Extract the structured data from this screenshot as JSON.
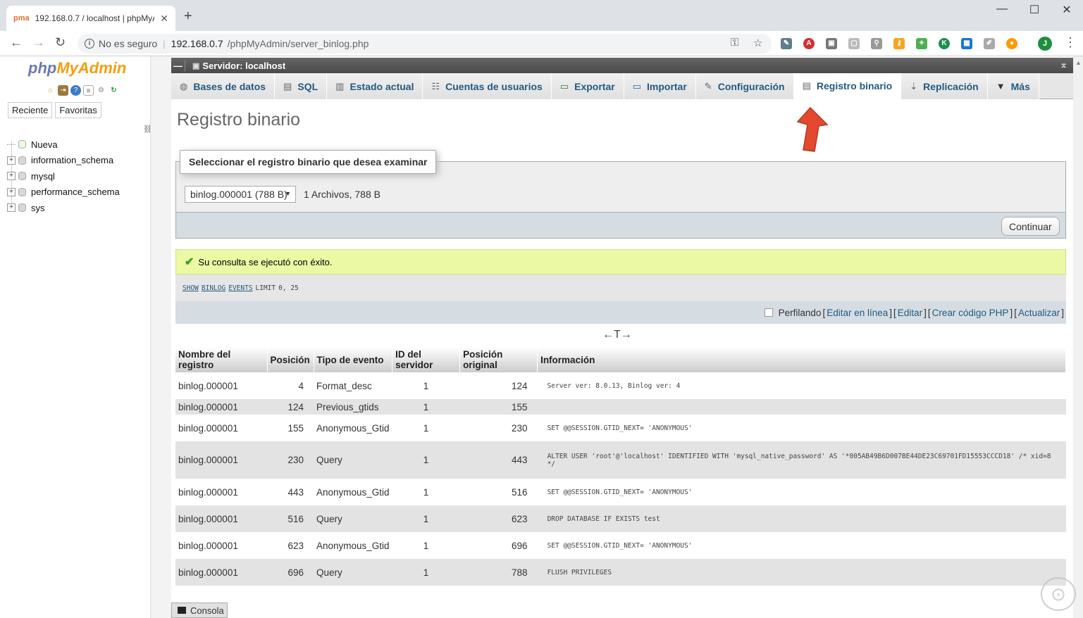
{
  "browser": {
    "tab_title": "192.168.0.7 / localhost | phpMyA",
    "new_tab_label": "+",
    "security_label": "No es seguro",
    "url_host": "192.168.0.7",
    "url_path": "/phpMyAdmin/server_binlog.php",
    "profile_initial": "J"
  },
  "nav": {
    "logo_php": "php",
    "logo_myadmin": "MyAdmin",
    "tabs": [
      "Reciente",
      "Favoritas"
    ],
    "tree": [
      {
        "label": "Nueva",
        "expandable": false
      },
      {
        "label": "information_schema",
        "expandable": true
      },
      {
        "label": "mysql",
        "expandable": true
      },
      {
        "label": "performance_schema",
        "expandable": true
      },
      {
        "label": "sys",
        "expandable": true
      }
    ]
  },
  "server_bar": {
    "title": "Servidor: localhost"
  },
  "menu": {
    "tabs": [
      {
        "label": "Bases de datos",
        "icon": "database-icon"
      },
      {
        "label": "SQL",
        "icon": "sql-icon"
      },
      {
        "label": "Estado actual",
        "icon": "status-icon"
      },
      {
        "label": "Cuentas de usuarios",
        "icon": "users-icon"
      },
      {
        "label": "Exportar",
        "icon": "export-icon"
      },
      {
        "label": "Importar",
        "icon": "import-icon"
      },
      {
        "label": "Configuración",
        "icon": "wrench-icon"
      },
      {
        "label": "Registro binario",
        "icon": "log-icon",
        "active": true
      },
      {
        "label": "Replicación",
        "icon": "replication-icon"
      },
      {
        "label": "Más",
        "icon": "caret-down-icon"
      }
    ]
  },
  "page": {
    "title": "Registro binario",
    "legend": "Seleccionar el registro binario que desea examinar",
    "select_value": "binlog.000001 (788 B)",
    "file_count": "1 Archivos, 788 B",
    "continue_label": "Continuar"
  },
  "result": {
    "success_message": "Su consulta se ejecutó con éxito.",
    "query_keywords": [
      "SHOW",
      "BINLOG",
      "EVENTS",
      "LIMIT"
    ],
    "query_args": "0, 25",
    "profiling_label": "Perfilando",
    "links": [
      "Editar en línea",
      "Editar",
      "Crear código PHP",
      "Actualizar"
    ],
    "resize_glyph": "←T→"
  },
  "table": {
    "headers": [
      "Nombre del registro",
      "Posición",
      "Tipo de evento",
      "ID del servidor",
      "Posición original",
      "Información"
    ],
    "rows": [
      {
        "log": "binlog.000001",
        "pos": "4",
        "type": "Format_desc",
        "server": "1",
        "end": "124",
        "info": "Server ver: 8.0.13, Binlog ver: 4"
      },
      {
        "log": "binlog.000001",
        "pos": "124",
        "type": "Previous_gtids",
        "server": "1",
        "end": "155",
        "info": ""
      },
      {
        "log": "binlog.000001",
        "pos": "155",
        "type": "Anonymous_Gtid",
        "server": "1",
        "end": "230",
        "info": "SET @@SESSION.GTID_NEXT= 'ANONYMOUS'"
      },
      {
        "log": "binlog.000001",
        "pos": "230",
        "type": "Query",
        "server": "1",
        "end": "443",
        "info": "ALTER USER 'root'@'localhost' IDENTIFIED WITH 'mysql_native_password' AS '*005AB49B6D007BE44DE23C69701FD15553CCCD18' /* xid=8 */"
      },
      {
        "log": "binlog.000001",
        "pos": "443",
        "type": "Anonymous_Gtid",
        "server": "1",
        "end": "516",
        "info": "SET @@SESSION.GTID_NEXT= 'ANONYMOUS'"
      },
      {
        "log": "binlog.000001",
        "pos": "516",
        "type": "Query",
        "server": "1",
        "end": "623",
        "info": "DROP DATABASE IF EXISTS test"
      },
      {
        "log": "binlog.000001",
        "pos": "623",
        "type": "Anonymous_Gtid",
        "server": "1",
        "end": "696",
        "info": "SET @@SESSION.GTID_NEXT= 'ANONYMOUS'"
      },
      {
        "log": "binlog.000001",
        "pos": "696",
        "type": "Query",
        "server": "1",
        "end": "788",
        "info": "FLUSH PRIVILEGES"
      }
    ]
  },
  "console": {
    "label": "Consola"
  },
  "colors": {
    "link": "#235a81",
    "success_bg": "#ebf8a4",
    "server_bar": "#4a4a4a",
    "arrow": "#e2492f"
  }
}
